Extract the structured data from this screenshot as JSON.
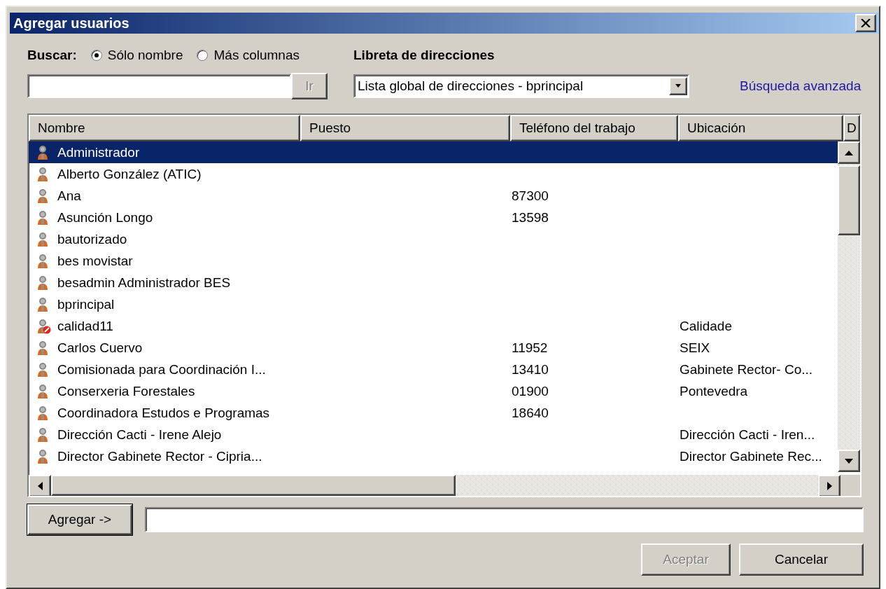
{
  "window": {
    "title": "Agregar usuarios"
  },
  "search": {
    "label": "Buscar:",
    "options": [
      {
        "label": "Sólo nombre",
        "selected": true
      },
      {
        "label": "Más columnas",
        "selected": false
      }
    ],
    "go_button": {
      "label": "Ir",
      "disabled": true
    }
  },
  "address_book": {
    "label": "Libreta de direcciones",
    "value": "Lista global de direcciones - bprincipal",
    "advanced_link": "Búsqueda avanzada"
  },
  "table": {
    "columns": [
      "Nombre",
      "Puesto",
      "Teléfono del trabajo",
      "Ubicación",
      "D"
    ],
    "rows": [
      {
        "kind": "user",
        "name": "Administrador",
        "phone": "",
        "location": "",
        "selected": true
      },
      {
        "kind": "user",
        "name": "Alberto González (ATIC)",
        "selected": false
      },
      {
        "kind": "user",
        "name": "Ana",
        "phone": "87300",
        "selected": false
      },
      {
        "kind": "user",
        "name": "Asunción Longo",
        "phone": "13598",
        "selected": false
      },
      {
        "kind": "user",
        "name": "bautorizado",
        "selected": false
      },
      {
        "kind": "user",
        "name": "bes movistar",
        "selected": false
      },
      {
        "kind": "user",
        "name": "besadmin Administrador BES",
        "selected": false
      },
      {
        "kind": "user",
        "name": "bprincipal",
        "selected": false
      },
      {
        "kind": "disabled-user",
        "name": "calidad11",
        "location": "Calidade",
        "selected": false
      },
      {
        "kind": "user",
        "name": "Carlos Cuervo",
        "phone": "11952",
        "location": "SEIX",
        "selected": false
      },
      {
        "kind": "user",
        "name": "Comisionada para Coordinación I...",
        "phone": "13410",
        "location": "Gabinete Rector- Co...",
        "selected": false
      },
      {
        "kind": "user",
        "name": "Conserxeria Forestales",
        "phone": "01900",
        "location": "Pontevedra",
        "selected": false
      },
      {
        "kind": "user",
        "name": "Coordinadora Estudos e Programas",
        "phone": "18640",
        "selected": false
      },
      {
        "kind": "user",
        "name": "Dirección Cacti - Irene Alejo",
        "location": "Dirección Cacti - Iren...",
        "selected": false
      },
      {
        "kind": "user",
        "name": "Director Gabinete Rector - Cipria...",
        "location": "Director Gabinete Rec...",
        "selected": false
      }
    ]
  },
  "add_button": {
    "label": "Agregar ->"
  },
  "buttons": [
    {
      "label": "Aceptar",
      "disabled": true
    },
    {
      "label": "Cancelar",
      "disabled": false
    }
  ]
}
